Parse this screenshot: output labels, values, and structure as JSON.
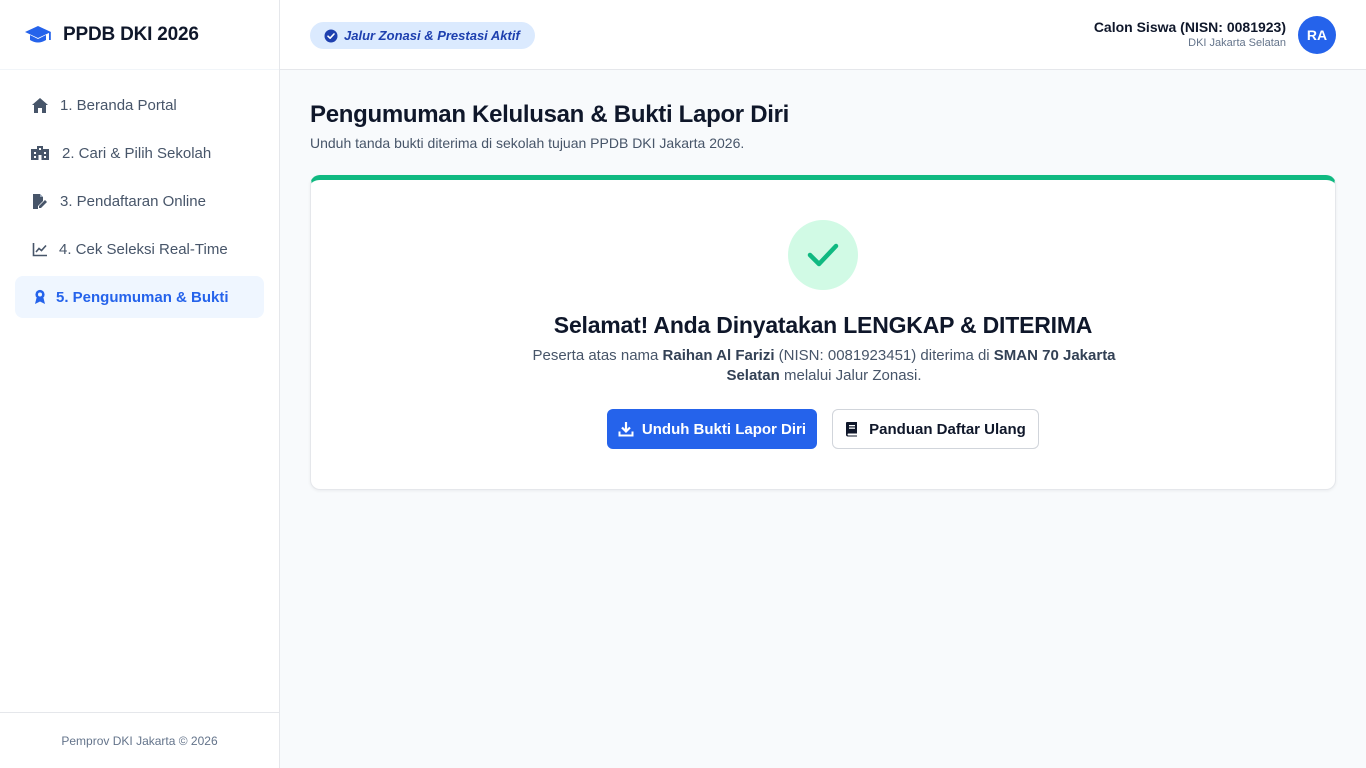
{
  "brand": {
    "title": "PPDB DKI 2026",
    "icon": "graduation-cap-icon",
    "accent": "#2563eb"
  },
  "sidebar": {
    "items": [
      {
        "label": "1. Beranda Portal",
        "icon": "home-icon"
      },
      {
        "label": "2. Cari & Pilih Sekolah",
        "icon": "school-building-icon"
      },
      {
        "label": "3. Pendaftaran Online",
        "icon": "file-edit-icon"
      },
      {
        "label": "4. Cek Seleksi Real-Time",
        "icon": "line-chart-icon"
      },
      {
        "label": "5. Pengumuman & Bukti",
        "icon": "award-icon",
        "active": true
      }
    ],
    "footer": "Pemprov DKI Jakarta © 2026"
  },
  "header": {
    "status_pill": "Jalur Zonasi & Prestasi Aktif",
    "user": {
      "name": "Calon Siswa (NISN: 0081923)",
      "region": "DKI Jakarta Selatan",
      "initials": "RA"
    }
  },
  "main": {
    "title": "Pengumuman Kelulusan & Bukti Lapor Diri",
    "subtitle": "Unduh tanda bukti diterima di sekolah tujuan PPDB DKI Jakarta 2026.",
    "result": {
      "title": "Selamat! Anda Dinyatakan LENGKAP & DITERIMA",
      "desc_prefix": "Peserta atas nama ",
      "student_name": "Raihan Al Farizi",
      "desc_middle": " (NISN: 0081923451) diterima di ",
      "school": "SMAN 70 Jakarta Selatan",
      "desc_suffix": " melalui Jalur Zonasi.",
      "status_color": "#10b981"
    },
    "actions": {
      "download_label": "Unduh Bukti Lapor Diri",
      "guide_label": "Panduan Daftar Ulang"
    }
  }
}
